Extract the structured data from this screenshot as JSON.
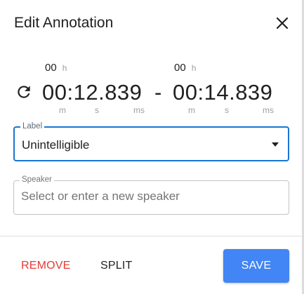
{
  "dialog": {
    "title": "Edit Annotation",
    "close_icon": "close-icon"
  },
  "time": {
    "reset_icon": "refresh-icon",
    "start": {
      "hours": "00",
      "time": "00:12.839"
    },
    "end": {
      "hours": "00",
      "time": "00:14.839"
    },
    "separator": "-",
    "units": {
      "hours": "h",
      "minutes": "m",
      "seconds": "s",
      "milliseconds": "ms"
    }
  },
  "label": {
    "legend": "Label",
    "value": "Unintelligible",
    "dropdown_icon": "arrow-drop-down-icon"
  },
  "speaker": {
    "legend": "Speaker",
    "placeholder": "Select or enter a new speaker",
    "value": ""
  },
  "actions": {
    "remove": "REMOVE",
    "split": "SPLIT",
    "save": "SAVE"
  },
  "colors": {
    "primary": "#4285f4",
    "focus_border": "#1976d2",
    "danger": "#e53935"
  }
}
